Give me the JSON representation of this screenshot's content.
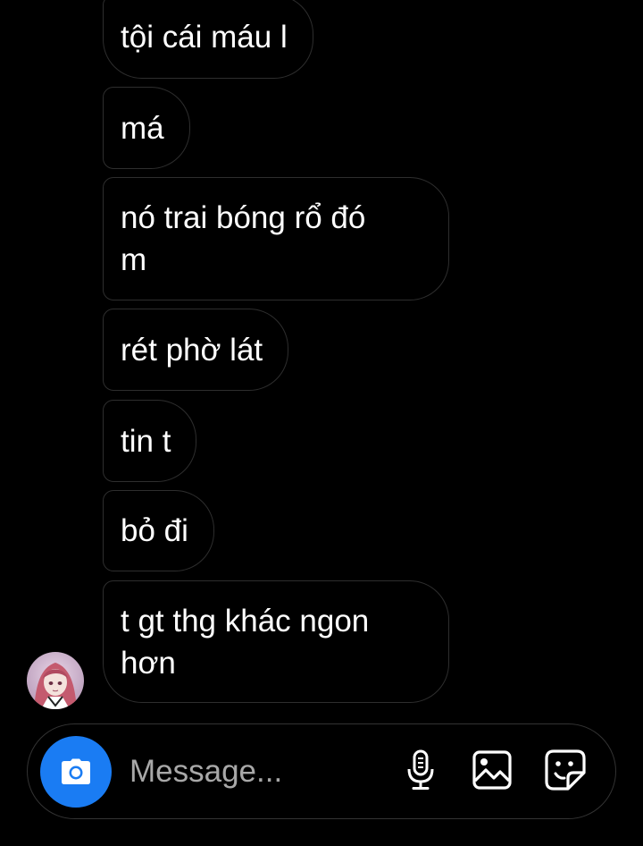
{
  "messages": [
    {
      "text": "tội cái máu l"
    },
    {
      "text": "má"
    },
    {
      "text": "nó trai bóng rổ đó\nm"
    },
    {
      "text": "rét phờ lát"
    },
    {
      "text": "tin t"
    },
    {
      "text": "bỏ đi"
    },
    {
      "text": "t gt thg khác ngon\nhơn"
    }
  ],
  "composer": {
    "placeholder": "Message...",
    "icons": [
      "camera-icon",
      "microphone-icon",
      "gallery-icon",
      "sticker-icon"
    ]
  },
  "colors": {
    "background": "#000000",
    "bubble_border": "#2e2e2e",
    "camera_button": "#1a7cf3",
    "placeholder": "#a8a8a8"
  }
}
